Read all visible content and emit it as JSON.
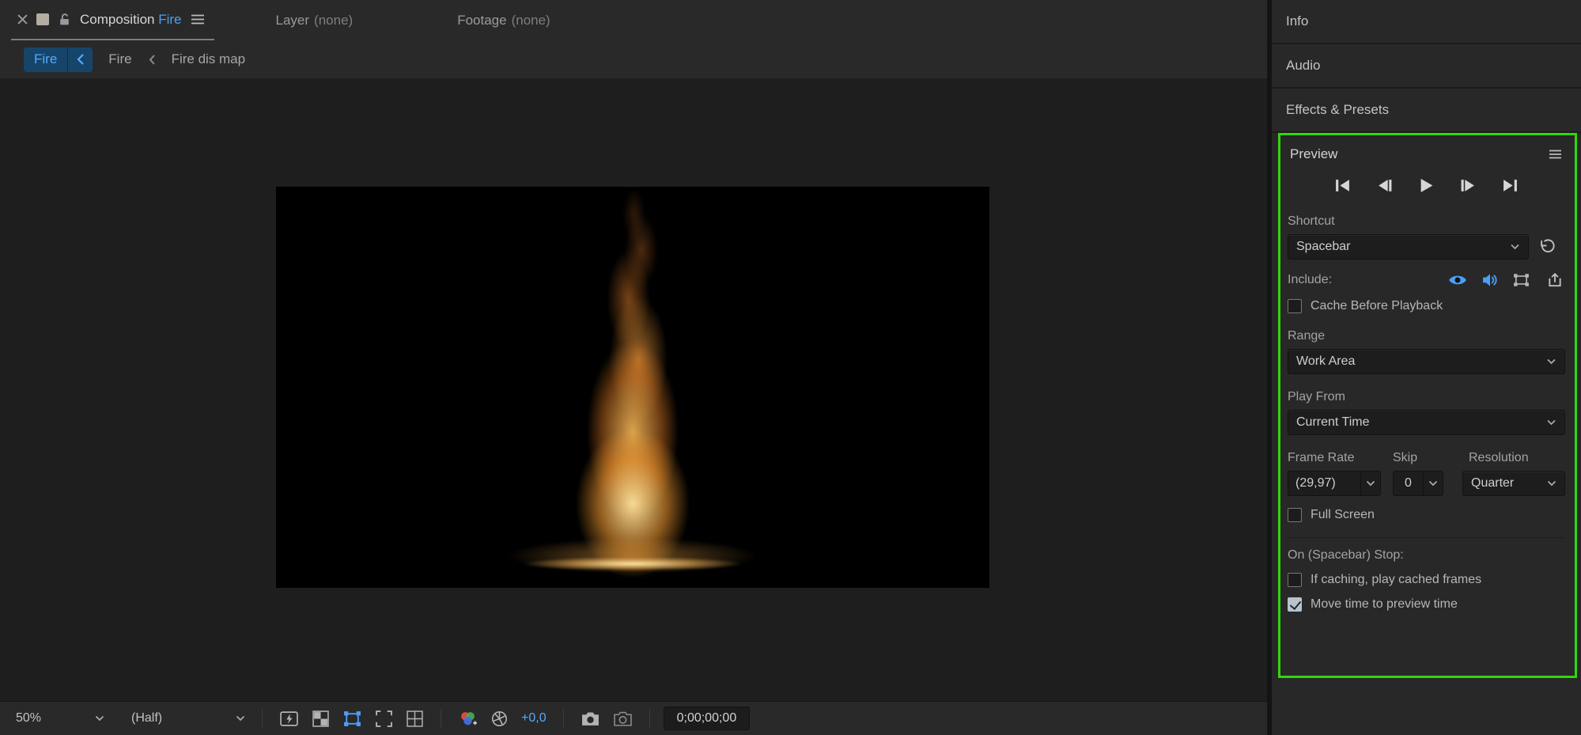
{
  "viewer_tabs": {
    "composition_label": "Composition",
    "composition_name": "Fire",
    "layer_label": "Layer",
    "layer_value": "(none)",
    "footage_label": "Footage",
    "footage_value": "(none)"
  },
  "breadcrumb": {
    "active": "Fire",
    "parent": "Fire",
    "grandparent": "Fire dis map"
  },
  "statusbar": {
    "zoom": "50%",
    "resolution": "(Half)",
    "exposure": "+0,0",
    "timecode": "0;00;00;00"
  },
  "right_panels": [
    "Info",
    "Audio",
    "Effects & Presets"
  ],
  "preview": {
    "title": "Preview",
    "shortcut_label": "Shortcut",
    "shortcut_value": "Spacebar",
    "include_label": "Include:",
    "cache_label": "Cache Before Playback",
    "cache_checked": false,
    "range_label": "Range",
    "range_value": "Work Area",
    "play_from_label": "Play From",
    "play_from_value": "Current Time",
    "frame_rate_label": "Frame Rate",
    "frame_rate_value": "(29,97)",
    "skip_label": "Skip",
    "skip_value": "0",
    "resolution_label": "Resolution",
    "resolution_value": "Quarter",
    "full_screen_label": "Full Screen",
    "full_screen_checked": false,
    "on_stop_label": "On (Spacebar) Stop:",
    "if_caching_label": "If caching, play cached frames",
    "if_caching_checked": false,
    "move_time_label": "Move time to preview time",
    "move_time_checked": true
  }
}
